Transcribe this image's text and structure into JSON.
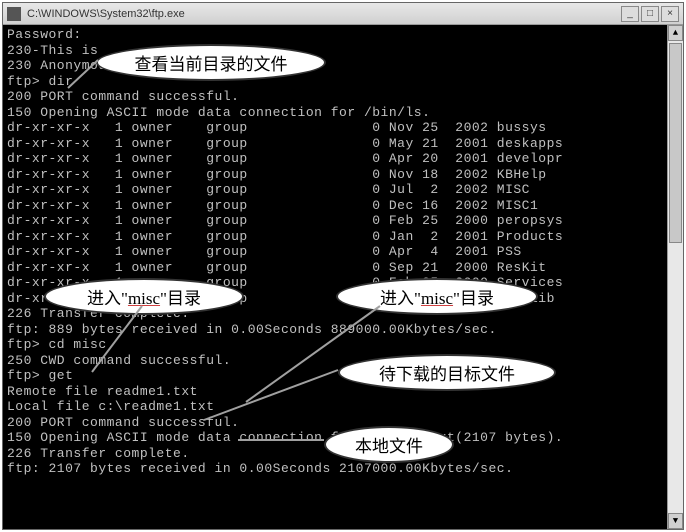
{
  "window": {
    "title": "C:\\WINDOWS\\System32\\ftp.exe",
    "min": "_",
    "max": "□",
    "close": "×"
  },
  "scrollbar": {
    "up": "▲",
    "down": "▼"
  },
  "lines": {
    "l0": "Password:",
    "l1": "230-This is ",
    "l1b": ".",
    "l2": "230 Anonymous user logged in.",
    "l3": "ftp> dir",
    "l4": "200 PORT command successful.",
    "l5": "150 Opening ASCII mode data connection for /bin/ls.",
    "d0": "dr-xr-xr-x   1 owner    group               0 Nov 25  2002 bussys",
    "d1": "dr-xr-xr-x   1 owner    group               0 May 21  2001 deskapps",
    "d2": "dr-xr-xr-x   1 owner    group               0 Apr 20  2001 developr",
    "d3": "dr-xr-xr-x   1 owner    group               0 Nov 18  2002 KBHelp",
    "d4": "dr-xr-xr-x   1 owner    group               0 Jul  2  2002 MISC",
    "d5": "dr-xr-xr-x   1 owner    group               0 Dec 16  2002 MISC1",
    "d6": "dr-xr-xr-x   1 owner    group               0 Feb 25  2000 peropsys",
    "d7": "dr-xr-xr-x   1 owner    group               0 Jan  2  2001 Products",
    "d8a": "dr-xr-xr-x   1 owner    group",
    "d8b": "               0 Apr  4  2001 PSS",
    "d9a": "dr-xr-xr-x   1 owner    group",
    "d9b": "               0 Sep 21  2000 ResKit",
    "d10": "dr-xr-xr-x   1 owner    group               0 Feb 25  2000 Services",
    "d11": "dr-xr-xr-x   1 owner    group               0 Feb 25  2000 Softlib",
    "l6": "226 Transfer complete.",
    "l7": "ftp: 889 bytes received in 0.00Seconds 889000.00Kbytes/sec.",
    "l8": "ftp> cd misc",
    "l9": "250 CWD command successful.",
    "l10": "ftp> get",
    "l11": "Remote file readme1.txt",
    "l12": "Local file c:\\readme1.txt",
    "l13": "200 PORT command successful.",
    "l14": "150 Opening ASCII mode data connection for readme1.txt(2107 bytes).",
    "l15": "226 Transfer complete.",
    "l16": "ftp: 2107 bytes received in 0.00Seconds 2107000.00Kbytes/sec."
  },
  "callouts": {
    "c1": "查看当前目录的文件",
    "c2a": "进入\"",
    "c2b": "misc",
    "c2c": "\"目录",
    "c3a": "进入\"",
    "c3b": "misc",
    "c3c": "\"目录",
    "c4": "待下载的目标文件",
    "c5": "本地文件"
  }
}
